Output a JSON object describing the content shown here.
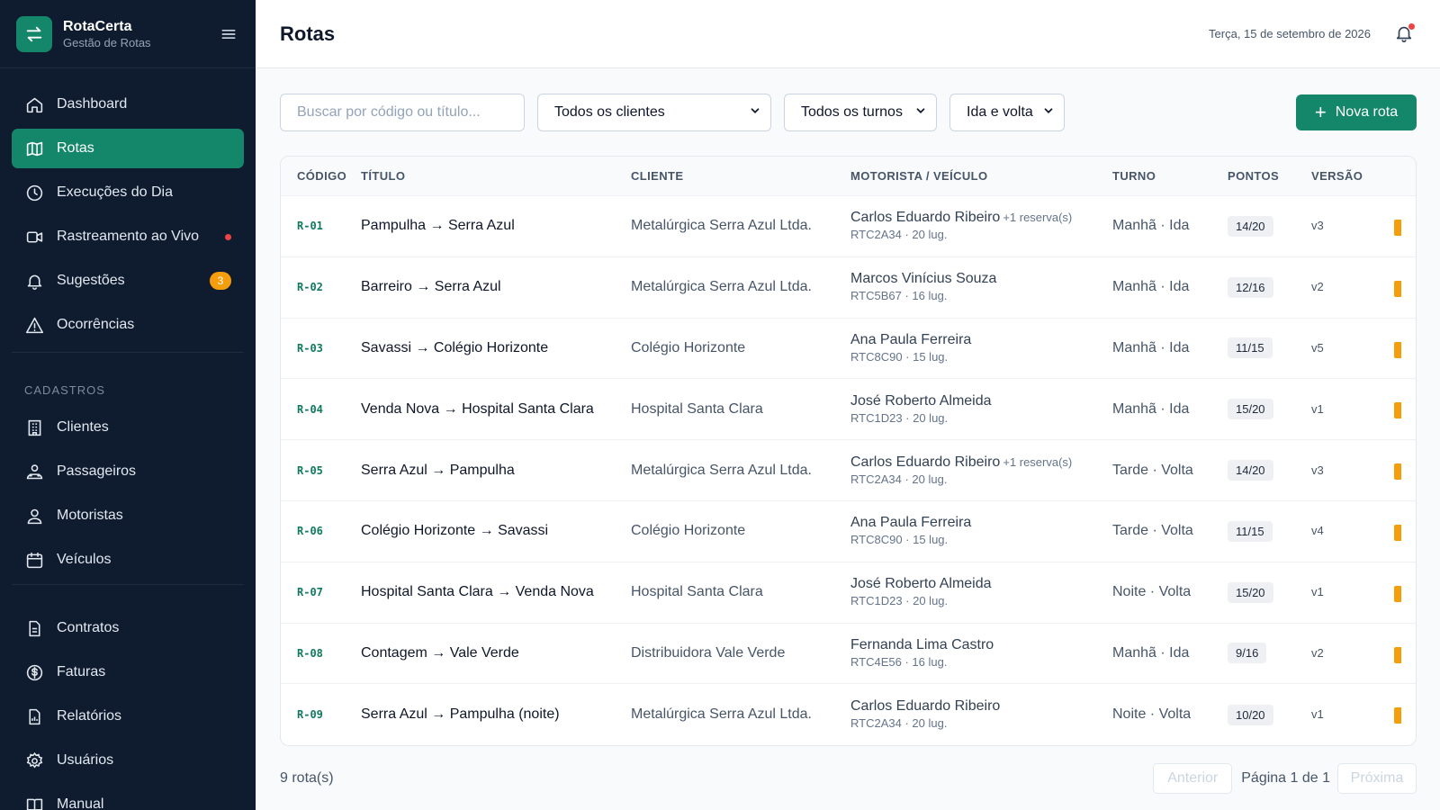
{
  "brand": {
    "name": "RotaCerta",
    "subtitle": "Gestão de Rotas",
    "color": "#14876b"
  },
  "sidebar": {
    "items": [
      {
        "label": "Dashboard",
        "icon": "home-icon"
      },
      {
        "label": "Rotas",
        "icon": "map-icon",
        "active": true
      },
      {
        "label": "Execuções do Dia",
        "icon": "clock-icon"
      },
      {
        "label": "Rastreamento ao Vivo",
        "icon": "video-icon",
        "live": true
      },
      {
        "label": "Sugestões",
        "icon": "bell-icon",
        "badge": "3"
      },
      {
        "label": "Ocorrências",
        "icon": "alert-triangle-icon"
      }
    ],
    "section_label": "CADASTROS",
    "cadastros": [
      {
        "label": "Clientes",
        "icon": "building-icon"
      },
      {
        "label": "Passageiros",
        "icon": "users-icon"
      },
      {
        "label": "Motoristas",
        "icon": "user-icon"
      },
      {
        "label": "Veículos",
        "icon": "calendar-icon"
      }
    ],
    "other": [
      {
        "label": "Contratos",
        "icon": "file-icon"
      },
      {
        "label": "Faturas",
        "icon": "dollar-icon"
      },
      {
        "label": "Relatórios",
        "icon": "report-icon"
      },
      {
        "label": "Usuários",
        "icon": "gear-icon"
      },
      {
        "label": "Manual",
        "icon": "book-icon"
      }
    ]
  },
  "header": {
    "title": "Rotas",
    "date": "Terça, 15 de setembro de 2026"
  },
  "toolbar": {
    "search_placeholder": "Buscar por código ou título...",
    "client_filter": "Todos os clientes",
    "shift_filter": "Todos os turnos",
    "direction_filter": "Ida e volta",
    "new_button": "Nova rota"
  },
  "table": {
    "columns": [
      "CÓDIGO",
      "TÍTULO",
      "CLIENTE",
      "MOTORISTA / VEÍCULO",
      "TURNO",
      "PONTOS",
      "VERSÃO"
    ],
    "rows": [
      {
        "code": "R-01",
        "title": "Pampulha → Serra Azul",
        "client": "Metalúrgica Serra Azul Ltda.",
        "driver": "Carlos Eduardo Ribeiro",
        "reserve": "+1 reserva(s)",
        "vehicle": "RTC2A34 · 20 lug.",
        "shift": "Manhã · Ida",
        "points": "14/20",
        "version": "v3"
      },
      {
        "code": "R-02",
        "title": "Barreiro → Serra Azul",
        "client": "Metalúrgica Serra Azul Ltda.",
        "driver": "Marcos Vinícius Souza",
        "reserve": "",
        "vehicle": "RTC5B67 · 16 lug.",
        "shift": "Manhã · Ida",
        "points": "12/16",
        "version": "v2"
      },
      {
        "code": "R-03",
        "title": "Savassi → Colégio Horizonte",
        "client": "Colégio Horizonte",
        "driver": "Ana Paula Ferreira",
        "reserve": "",
        "vehicle": "RTC8C90 · 15 lug.",
        "shift": "Manhã · Ida",
        "points": "11/15",
        "version": "v5"
      },
      {
        "code": "R-04",
        "title": "Venda Nova → Hospital Santa Clara",
        "client": "Hospital Santa Clara",
        "driver": "José Roberto Almeida",
        "reserve": "",
        "vehicle": "RTC1D23 · 20 lug.",
        "shift": "Manhã · Ida",
        "points": "15/20",
        "version": "v1"
      },
      {
        "code": "R-05",
        "title": "Serra Azul → Pampulha",
        "client": "Metalúrgica Serra Azul Ltda.",
        "driver": "Carlos Eduardo Ribeiro",
        "reserve": "+1 reserva(s)",
        "vehicle": "RTC2A34 · 20 lug.",
        "shift": "Tarde · Volta",
        "points": "14/20",
        "version": "v3"
      },
      {
        "code": "R-06",
        "title": "Colégio Horizonte → Savassi",
        "client": "Colégio Horizonte",
        "driver": "Ana Paula Ferreira",
        "reserve": "",
        "vehicle": "RTC8C90 · 15 lug.",
        "shift": "Tarde · Volta",
        "points": "11/15",
        "version": "v4"
      },
      {
        "code": "R-07",
        "title": "Hospital Santa Clara → Venda Nova",
        "client": "Hospital Santa Clara",
        "driver": "José Roberto Almeida",
        "reserve": "",
        "vehicle": "RTC1D23 · 20 lug.",
        "shift": "Noite · Volta",
        "points": "15/20",
        "version": "v1"
      },
      {
        "code": "R-08",
        "title": "Contagem → Vale Verde",
        "client": "Distribuidora Vale Verde",
        "driver": "Fernanda Lima Castro",
        "reserve": "",
        "vehicle": "RTC4E56 · 16 lug.",
        "shift": "Manhã · Ida",
        "points": "9/16",
        "version": "v2"
      },
      {
        "code": "R-09",
        "title": "Serra Azul → Pampulha (noite)",
        "client": "Metalúrgica Serra Azul Ltda.",
        "driver": "Carlos Eduardo Ribeiro",
        "reserve": "",
        "vehicle": "RTC2A34 · 20 lug.",
        "shift": "Noite · Volta",
        "points": "10/20",
        "version": "v1"
      }
    ]
  },
  "footer": {
    "count": "9 rota(s)",
    "prev": "Anterior",
    "page": "Página 1 de 1",
    "next": "Próxima"
  },
  "colors": {
    "accent": "#14876b",
    "sidebar_bg": "#0f1b2e",
    "status": "#f59e0b",
    "alert": "#ef4444"
  }
}
